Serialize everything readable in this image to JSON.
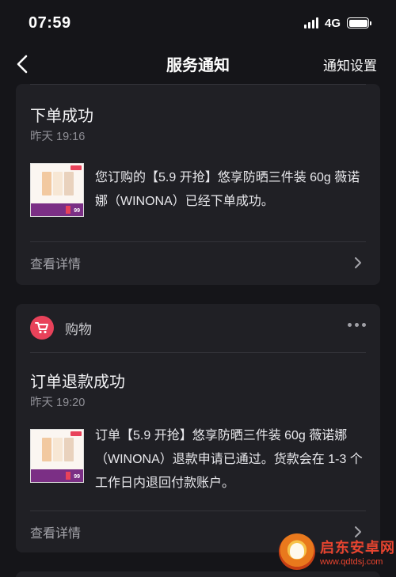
{
  "status_bar": {
    "time": "07:59",
    "network": "4G"
  },
  "nav": {
    "title": "服务通知",
    "settings_label": "通知设置"
  },
  "cards": [
    {
      "title": "下单成功",
      "time": "昨天 19:16",
      "body": "您订购的【5.9 开抢】悠享防晒三件装 60g 薇诺娜（WINONA）已经下单成功。",
      "detail_label": "查看详情"
    },
    {
      "category": "购物",
      "title": "订单退款成功",
      "time": "昨天 19:20",
      "body": "订单【5.9 开抢】悠享防晒三件装 60g 薇诺娜（WINONA）退款申请已通过。货款会在 1-3 个工作日内退回付款账户。",
      "detail_label": "查看详情"
    }
  ],
  "thumbnail": {
    "price": "99"
  },
  "watermark": {
    "name": "启东安卓网",
    "url": "www.qdtdsj.com"
  },
  "colors": {
    "background": "#151519",
    "card": "#202025",
    "accent_badge": "#e8425a"
  }
}
